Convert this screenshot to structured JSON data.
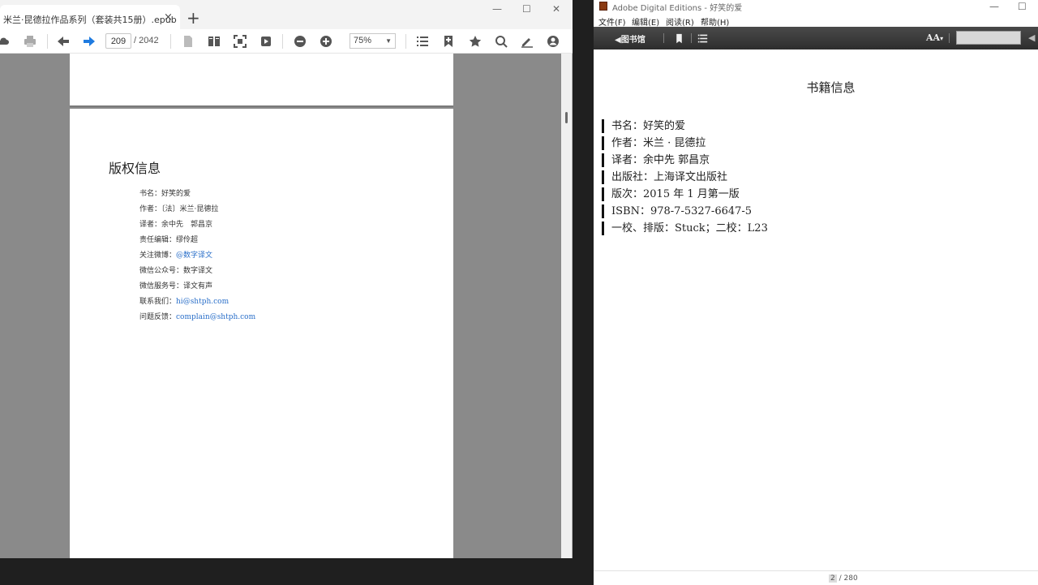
{
  "left_window": {
    "tab_title": "米兰·昆德拉作品系列（套装共15册）.epub",
    "tab_close": "×",
    "new_tab": "+",
    "window_controls": {
      "minimize": "—",
      "maximize": "☐",
      "close": "✕"
    },
    "toolbar": {
      "current_page": "209",
      "total_pages": "/ 2042",
      "zoom": "75%"
    },
    "page": {
      "title": "版权信息",
      "lines": [
        {
          "label": "书名：",
          "value": "好笑的爱",
          "link": false
        },
        {
          "label": "作者：",
          "value": "〔法〕米兰·昆德拉",
          "link": false
        },
        {
          "label": "译者：",
          "value": "余中先　郭昌京",
          "link": false
        },
        {
          "label": "责任编辑：",
          "value": "缪伶超",
          "link": false
        },
        {
          "label": "关注微博：",
          "value": "@数字译文",
          "link": true
        },
        {
          "label": "微信公众号：",
          "value": "数字译文",
          "link": false
        },
        {
          "label": "微信服务号：",
          "value": "译文有声",
          "link": false
        },
        {
          "label": "联系我们：",
          "value": "hi@shtph.com",
          "link": true
        },
        {
          "label": "问题反馈：",
          "value": "complain@shtph.com",
          "link": true
        }
      ]
    }
  },
  "right_window": {
    "title": "Adobe Digital Editions - 好笑的爱",
    "window_controls": {
      "minimize": "—",
      "maximize": "☐"
    },
    "menu": [
      "文件(F)",
      "编辑(E)",
      "阅读(R)",
      "帮助(H)"
    ],
    "toolbar": {
      "library": "◀图书馆",
      "font_size": "AA"
    },
    "content": {
      "title": "书籍信息",
      "lines": [
        "书名：好笑的爱",
        "作者：米兰 · 昆德拉",
        "译者：余中先 郭昌京",
        "出版社：上海译文出版社",
        "版次：2015 年 1 月第一版",
        "ISBN：978-7-5327-6647-5",
        "一校、排版：Stuck；二校：L23"
      ]
    },
    "status": {
      "current_page": "2",
      "total_pages": "/ 280"
    }
  },
  "icons": [
    "cloud-icon",
    "print-icon",
    "back-arrow-icon",
    "forward-arrow-icon",
    "single-page-icon",
    "two-page-icon",
    "fit-screen-icon",
    "slideshow-icon",
    "zoom-out-icon",
    "zoom-in-icon",
    "toc-icon",
    "add-bookmark-icon",
    "star-icon",
    "search-icon",
    "annotate-icon",
    "account-icon",
    "bookmark-icon",
    "list-icon"
  ]
}
